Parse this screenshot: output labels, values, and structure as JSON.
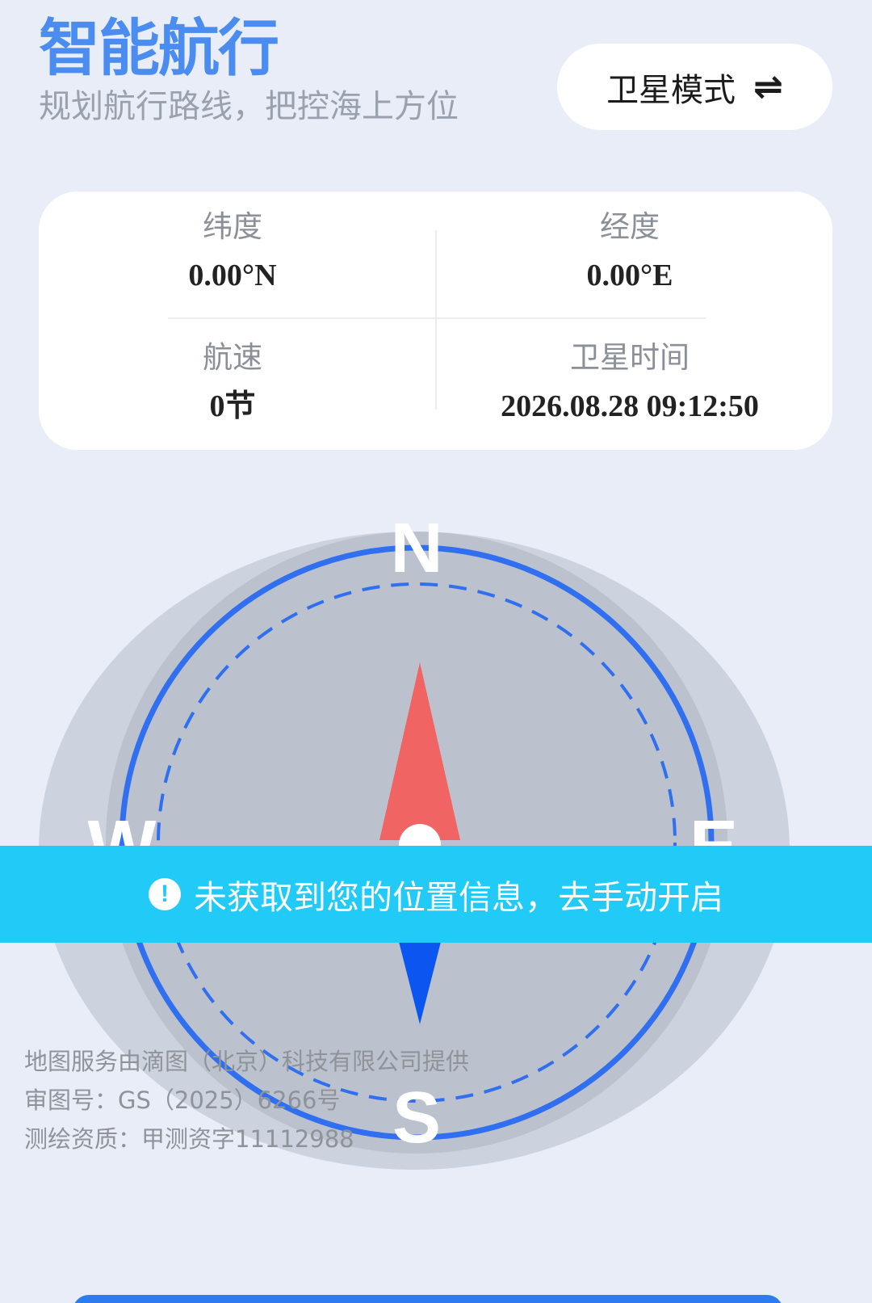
{
  "header": {
    "title": "智能航行",
    "subtitle": "规划航行路线，把控海上方位"
  },
  "mode_button": {
    "label": "卫星模式",
    "icon": "swap-arrows-icon"
  },
  "info": {
    "latitude": {
      "label": "纬度",
      "value": "0.00°N"
    },
    "longitude": {
      "label": "经度",
      "value": "0.00°E"
    },
    "speed": {
      "label": "航速",
      "value": "0节"
    },
    "satellite_time": {
      "label": "卫星时间",
      "value": "2026.08.28 09:12:50"
    }
  },
  "compass": {
    "north": "N",
    "south": "S",
    "west": "W",
    "east": "E",
    "colors": {
      "ring": "#2f6ff0",
      "north_needle": "#f06464",
      "south_needle": "#0b56f0",
      "outer": "#cdd3de",
      "inner": "#bcc2cd"
    }
  },
  "alert": {
    "icon": "exclamation-icon",
    "text": "未获取到您的位置信息，去手动开启"
  },
  "credits": {
    "line1": "地图服务由滴图（北京）科技有限公司提供",
    "line2": "审图号：GS（2025）6266号",
    "line3": "测绘资质：甲测资字11112988"
  }
}
